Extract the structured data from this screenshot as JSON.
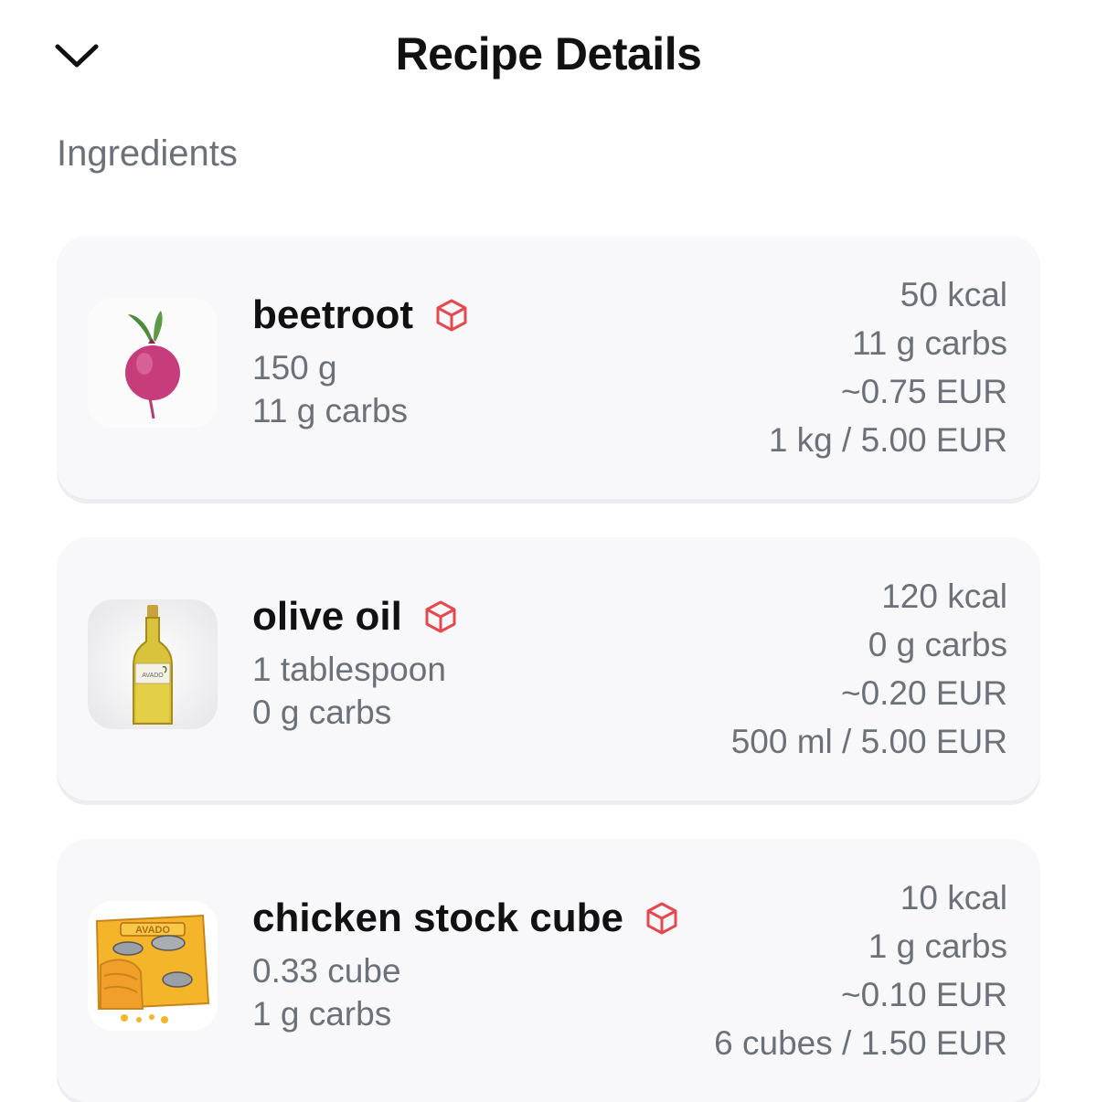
{
  "header": {
    "title": "Recipe Details",
    "back_icon": "chevron-down-icon"
  },
  "section": {
    "label": "Ingredients"
  },
  "colors": {
    "badge": "#e5484d",
    "muted": "#6b7079",
    "card_bg": "#f8f8fb"
  },
  "ingredients": [
    {
      "name": "beetroot",
      "quantity": "150 g",
      "carbs": "11 g carbs",
      "icon": "cube-icon",
      "kcal": "50 kcal",
      "carbs_right": "11 g carbs",
      "cost": "~0.75 EUR",
      "price": "1 kg / 5.00 EUR"
    },
    {
      "name": "olive oil",
      "quantity": "1 tablespoon",
      "carbs": "0 g carbs",
      "icon": "cube-icon",
      "kcal": "120 kcal",
      "carbs_right": "0 g carbs",
      "cost": "~0.20 EUR",
      "price": "500 ml / 5.00 EUR",
      "label_text": "AVADO"
    },
    {
      "name": "chicken stock cube",
      "quantity": "0.33 cube",
      "carbs": "1 g carbs",
      "icon": "cube-icon",
      "kcal": "10 kcal",
      "carbs_right": "1 g carbs",
      "cost": "~0.10 EUR",
      "price": "6 cubes / 1.50 EUR",
      "label_text": "AVADO"
    }
  ]
}
